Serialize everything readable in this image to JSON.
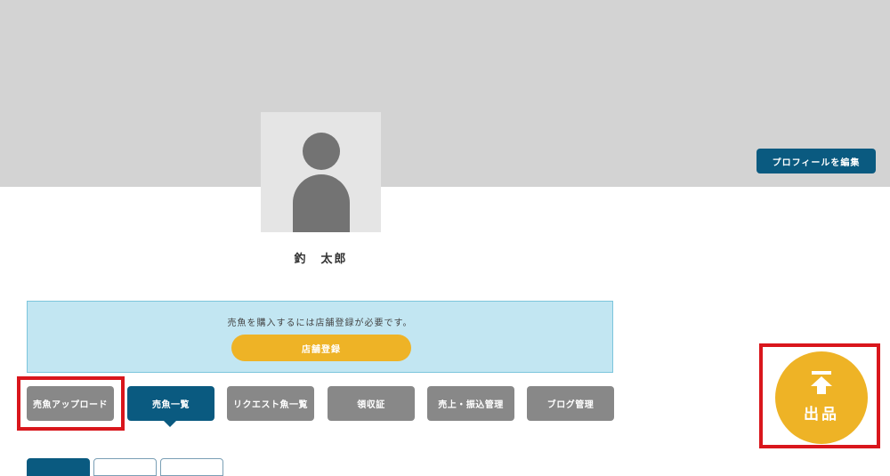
{
  "profile": {
    "edit_button_label": "プロフィールを編集",
    "user_name": "釣　太郎"
  },
  "notice": {
    "message": "売魚を購入するには店舗登録が必要です。",
    "register_button_label": "店舗登録"
  },
  "tabs": [
    {
      "label": "売魚アップロード",
      "active": false
    },
    {
      "label": "売魚一覧",
      "active": true
    },
    {
      "label": "リクエスト魚一覧",
      "active": false
    },
    {
      "label": "領収証",
      "active": false
    },
    {
      "label": "売上・振込管理",
      "active": false
    },
    {
      "label": "ブログ管理",
      "active": false
    }
  ],
  "fab": {
    "label": "出品",
    "icon": "upload-icon"
  },
  "colors": {
    "primary": "#0a5a80",
    "accent": "#eeb326",
    "highlight": "#d9161c",
    "tab_inactive": "#888888"
  }
}
